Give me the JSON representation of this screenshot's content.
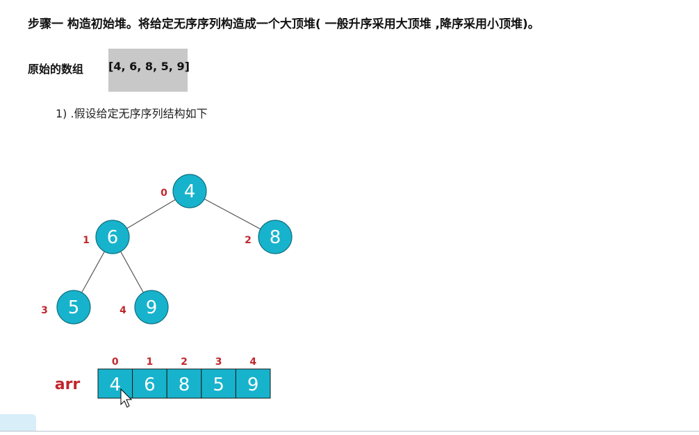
{
  "title": "步骤一 构造初始堆。将给定无序序列构造成一个大顶堆( 一般升序采用大顶堆 ,降序采用小顶堆)。",
  "original": {
    "label": "原始的数组",
    "array_text": "[4, 6, 8, 5, 9]"
  },
  "sub_step": "1) .假设给定无序序列结构如下",
  "colors": {
    "node_fill": "#17b3cc",
    "node_stroke": "#0e6f80",
    "index_label": "#c0272d",
    "edge": "#555555",
    "arr_label": "#c0272d"
  },
  "tree": {
    "nodes": [
      {
        "index_label": "0",
        "value": "4"
      },
      {
        "index_label": "1",
        "value": "6"
      },
      {
        "index_label": "2",
        "value": "8"
      },
      {
        "index_label": "3",
        "value": "5"
      },
      {
        "index_label": "4",
        "value": "9"
      }
    ],
    "edges": [
      {
        "from": 0,
        "to": 1
      },
      {
        "from": 0,
        "to": 2
      },
      {
        "from": 1,
        "to": 3
      },
      {
        "from": 1,
        "to": 4
      }
    ]
  },
  "array": {
    "label": "arr",
    "indices": [
      "0",
      "1",
      "2",
      "3",
      "4"
    ],
    "values": [
      "4",
      "6",
      "8",
      "5",
      "9"
    ]
  }
}
